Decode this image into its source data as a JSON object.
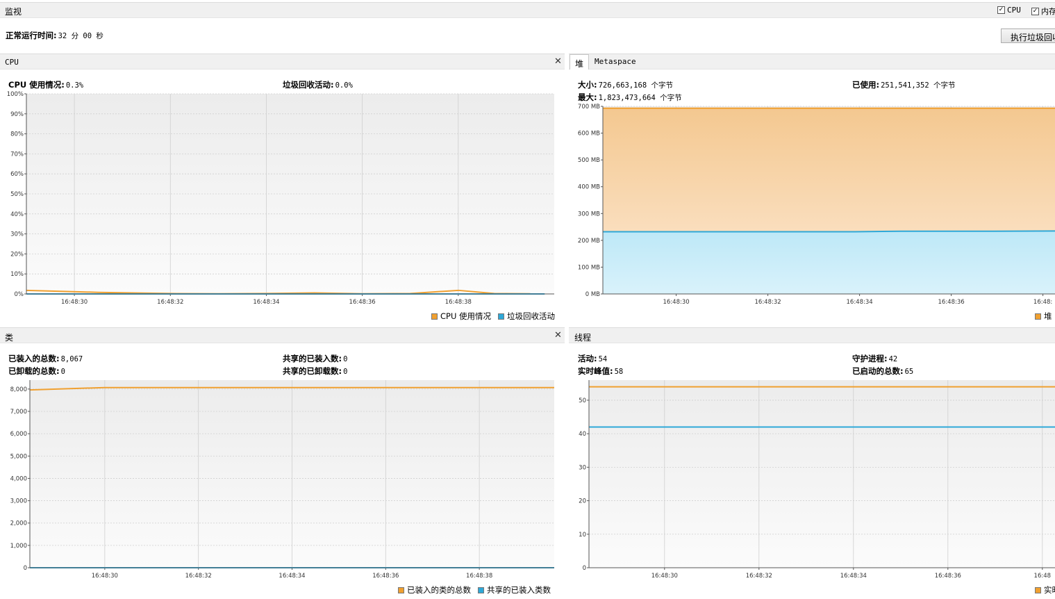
{
  "header": {
    "title": "监视",
    "checkbox_cpu": "CPU",
    "checkbox_mem": "内存",
    "uptime_label": "正常运行时间:",
    "uptime_value": "32 分 00 秒",
    "gc_button": "执行垃圾回收"
  },
  "colors": {
    "orange": "#f0a030",
    "blue": "#2ea8d8"
  },
  "cpu": {
    "title": "CPU",
    "usage_label": "CPU 使用情况:",
    "usage_value": "0.3%",
    "gc_label": "垃圾回收活动:",
    "gc_value": "0.0%",
    "legend_usage": "CPU 使用情况",
    "legend_gc": "垃圾回收活动"
  },
  "heap": {
    "tab_heap": "堆",
    "tab_meta": "Metaspace",
    "size_label": "大小:",
    "size_value": "726,663,168 个字节",
    "used_label": "已使用:",
    "used_value": "251,541,352 个字节",
    "max_label": "最大:",
    "max_value": "1,823,473,664 个字节",
    "legend_heap": "堆"
  },
  "classes": {
    "title": "类",
    "loaded_label": "已装入的总数:",
    "loaded_value": "8,067",
    "shared_loaded_label": "共享的已装入数:",
    "shared_loaded_value": "0",
    "unloaded_label": "已卸载的总数:",
    "unloaded_value": "0",
    "shared_unloaded_label": "共享的已卸载数:",
    "shared_unloaded_value": "0",
    "legend_loaded": "已装入的类的总数",
    "legend_shared": "共享的已装入类数"
  },
  "threads": {
    "title": "线程",
    "live_label": "活动:",
    "live_value": "54",
    "daemon_label": "守护进程:",
    "daemon_value": "42",
    "peak_label": "实时峰值:",
    "peak_value": "58",
    "started_label": "已启动的总数:",
    "started_value": "65",
    "legend_live": "实时"
  },
  "chart_data": [
    {
      "type": "line",
      "name": "cpu",
      "x_ticks": [
        "16:48:30",
        "16:48:32",
        "16:48:34",
        "16:48:36",
        "16:48:38"
      ],
      "y_ticks": [
        "0%",
        "10%",
        "20%",
        "30%",
        "40%",
        "50%",
        "60%",
        "70%",
        "80%",
        "90%",
        "100%"
      ],
      "ylim": [
        0,
        100
      ],
      "grid": true,
      "series": [
        {
          "name": "CPU 使用情况",
          "color": "#f0a030",
          "x": [
            0,
            1.5,
            3,
            4,
            5,
            6,
            7,
            8,
            9,
            9.75,
            10.5
          ],
          "y": [
            1.8,
            0.8,
            0.2,
            0.1,
            0.2,
            0.5,
            0.1,
            0.2,
            1.8,
            0.2,
            0.1
          ]
        },
        {
          "name": "垃圾回收活动",
          "color": "#2ea8d8",
          "x": [
            0,
            10.8
          ],
          "y": [
            0,
            0
          ]
        }
      ]
    },
    {
      "type": "area",
      "name": "heap",
      "x_ticks": [
        "16:48:30",
        "16:48:32",
        "16:48:34",
        "16:48:36",
        "16:48:"
      ],
      "y_ticks": [
        "0 MB",
        "100 MB",
        "200 MB",
        "300 MB",
        "400 MB",
        "500 MB",
        "600 MB",
        "700 MB"
      ],
      "ylim": [
        0,
        700
      ],
      "grid": true,
      "series": [
        {
          "name": "大小",
          "color": "#f0a030",
          "x": [
            0,
            10
          ],
          "y": [
            693,
            693
          ]
        },
        {
          "name": "已使用",
          "color": "#2ea8d8",
          "x": [
            0,
            3,
            5.5,
            6.5,
            8.5,
            10
          ],
          "y": [
            232,
            232,
            232,
            234,
            234,
            235
          ]
        }
      ]
    },
    {
      "type": "line",
      "name": "classes",
      "x_ticks": [
        "16:48:30",
        "16:48:32",
        "16:48:34",
        "16:48:36",
        "16:48:38"
      ],
      "y_ticks": [
        "0",
        "1,000",
        "2,000",
        "3,000",
        "4,000",
        "5,000",
        "6,000",
        "7,000",
        "8,000"
      ],
      "ylim": [
        0,
        8400
      ],
      "grid": true,
      "series": [
        {
          "name": "已装入的类的总数",
          "color": "#f0a030",
          "x": [
            0,
            1.6,
            11.2
          ],
          "y": [
            7960,
            8067,
            8067
          ]
        },
        {
          "name": "共享的已装入类数",
          "color": "#2ea8d8",
          "x": [
            0,
            11.2
          ],
          "y": [
            0,
            0
          ]
        }
      ]
    },
    {
      "type": "line",
      "name": "threads",
      "x_ticks": [
        "16:48:30",
        "16:48:32",
        "16:48:34",
        "16:48:36",
        "16:48"
      ],
      "y_ticks": [
        "0",
        "10",
        "20",
        "30",
        "40",
        "50"
      ],
      "ylim": [
        0,
        56
      ],
      "grid": true,
      "series": [
        {
          "name": "活动",
          "color": "#f0a030",
          "x": [
            0,
            10
          ],
          "y": [
            54,
            54
          ]
        },
        {
          "name": "守护进程",
          "color": "#2ea8d8",
          "x": [
            0,
            10
          ],
          "y": [
            42,
            42
          ]
        }
      ]
    }
  ]
}
